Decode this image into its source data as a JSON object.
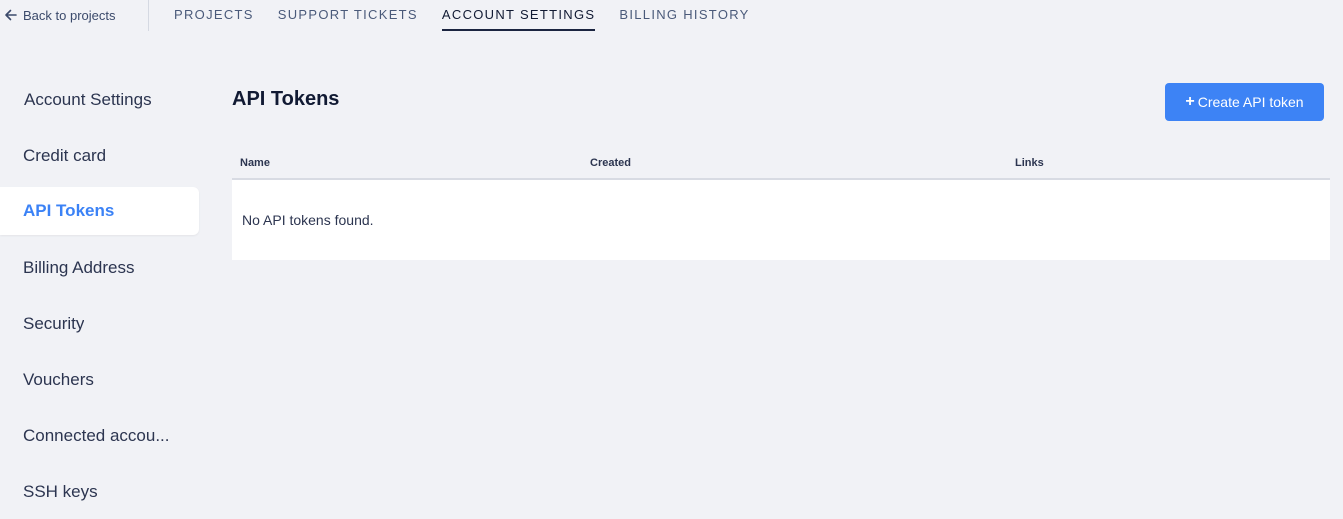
{
  "topnav": {
    "back_label": "Back to projects",
    "tabs": [
      {
        "label": "PROJECTS",
        "active": false
      },
      {
        "label": "SUPPORT TICKETS",
        "active": false
      },
      {
        "label": "ACCOUNT SETTINGS",
        "active": true
      },
      {
        "label": "BILLING HISTORY",
        "active": false
      }
    ]
  },
  "sidebar": {
    "items": [
      {
        "label": "Account Settings"
      },
      {
        "label": "Credit card"
      },
      {
        "label": "API Tokens",
        "active": true
      },
      {
        "label": "Billing Address"
      },
      {
        "label": "Security"
      },
      {
        "label": "Vouchers"
      },
      {
        "label": "Connected accou..."
      },
      {
        "label": "SSH keys"
      }
    ]
  },
  "main": {
    "title": "API Tokens",
    "create_button_label": "Create API token",
    "table": {
      "columns": [
        "Name",
        "Created",
        "Links"
      ],
      "empty_message": "No API tokens found."
    }
  },
  "colors": {
    "accent": "#3d83f5",
    "background": "#f1f2f6",
    "text": "#1f2a44"
  }
}
